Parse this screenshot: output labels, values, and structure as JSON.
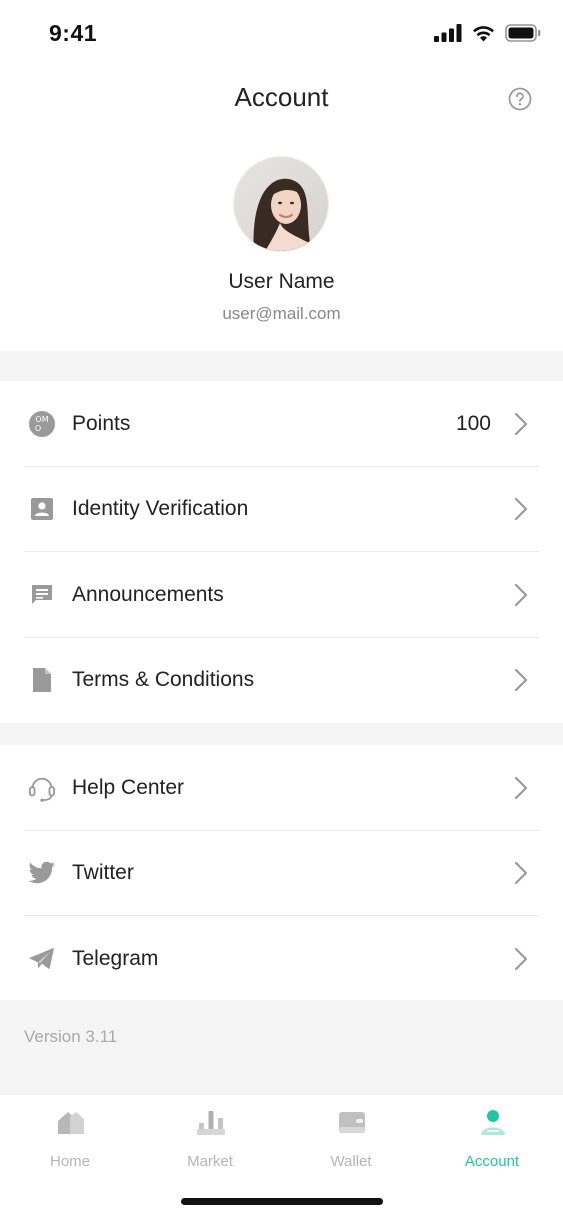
{
  "status_bar": {
    "time": "9:41"
  },
  "nav": {
    "title": "Account"
  },
  "profile": {
    "name": "User Name",
    "email": "user@mail.com"
  },
  "menu_group_1": [
    {
      "label": "Points",
      "value": "100",
      "icon": "points-coin-icon"
    },
    {
      "label": "Identity Verification",
      "icon": "id-card-icon"
    },
    {
      "label": "Announcements",
      "icon": "message-icon"
    },
    {
      "label": "Terms & Conditions",
      "icon": "document-icon"
    }
  ],
  "menu_group_2": [
    {
      "label": "Help Center",
      "icon": "headset-icon"
    },
    {
      "label": "Twitter",
      "icon": "twitter-icon"
    },
    {
      "label": "Telegram",
      "icon": "telegram-icon"
    }
  ],
  "version": "Version 3.11",
  "tabbar": {
    "tabs": [
      {
        "label": "Home",
        "icon": "home-icon",
        "active": false
      },
      {
        "label": "Market",
        "icon": "market-icon",
        "active": false
      },
      {
        "label": "Wallet",
        "icon": "wallet-icon",
        "active": false
      },
      {
        "label": "Account",
        "icon": "account-icon",
        "active": true
      }
    ]
  },
  "colors": {
    "accent": "#1fc8a2",
    "icon_gray": "#9a9a9a",
    "divider": "#e9e9e9",
    "section_bg": "#f5f5f5"
  }
}
